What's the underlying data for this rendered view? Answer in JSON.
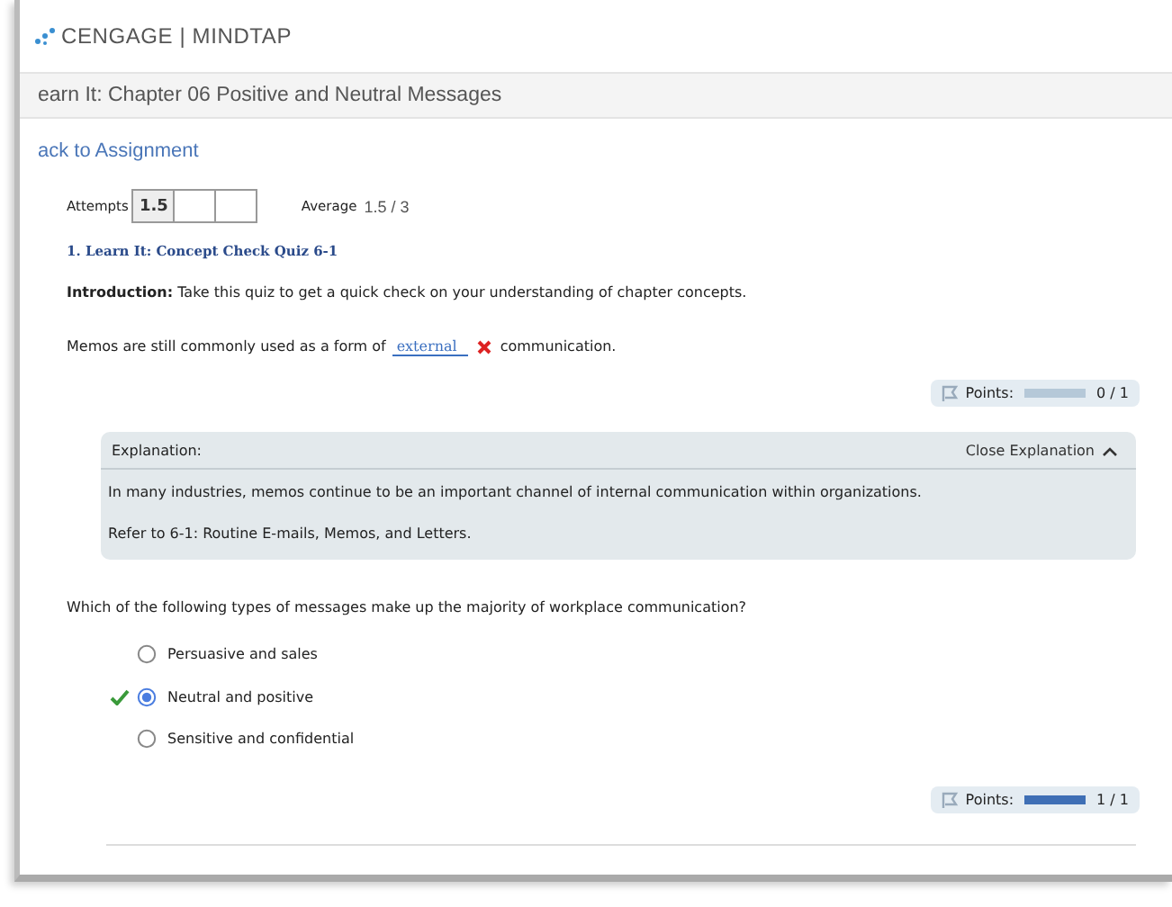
{
  "header": {
    "logo": "CENGAGE | MINDTAP"
  },
  "page_title": "earn It: Chapter 06 Positive and Neutral Messages",
  "back_link": "ack to Assignment",
  "attempts": {
    "label": "Attempts",
    "slots": [
      {
        "value": "1.5",
        "filled": true
      },
      {
        "filled": false
      },
      {
        "filled": false
      }
    ],
    "average_label": "Average",
    "average": "1.5 / 3"
  },
  "quiz_title": "1. Learn It: Concept Check Quiz 6-1",
  "introduction": "**Introduction:** Take this quiz to get a quick check on your understanding of chapter concepts.",
  "questions": [
    {
      "kind": "fill_in",
      "text_before": "Memos are still commonly used as a form of",
      "answer": "external",
      "correct": false,
      "text_after": "communication.",
      "points": {
        "label": "Points:",
        "level": 0,
        "reading": "0 / 1"
      },
      "explanation": {
        "title": "Explanation:",
        "toggle": "Close Explanation",
        "expanded": true,
        "paragraphs": [
          "In many industries, memos continue to be an important channel of internal communication within organizations.",
          "Refer to 6-1: Routine E-mails, Memos, and Letters."
        ]
      }
    },
    {
      "kind": "choice",
      "prompt": "Which of the following types of messages make up the majority of workplace communication?",
      "options": [
        {
          "label": "Persuasive and sales",
          "selected": false,
          "correct": false
        },
        {
          "label": "Neutral and positive",
          "selected": true,
          "correct": true
        },
        {
          "label": "Sensitive and confidential",
          "selected": false,
          "correct": false
        }
      ],
      "points": {
        "label": "Points:",
        "level": 1,
        "reading": "1 / 1"
      }
    }
  ]
}
